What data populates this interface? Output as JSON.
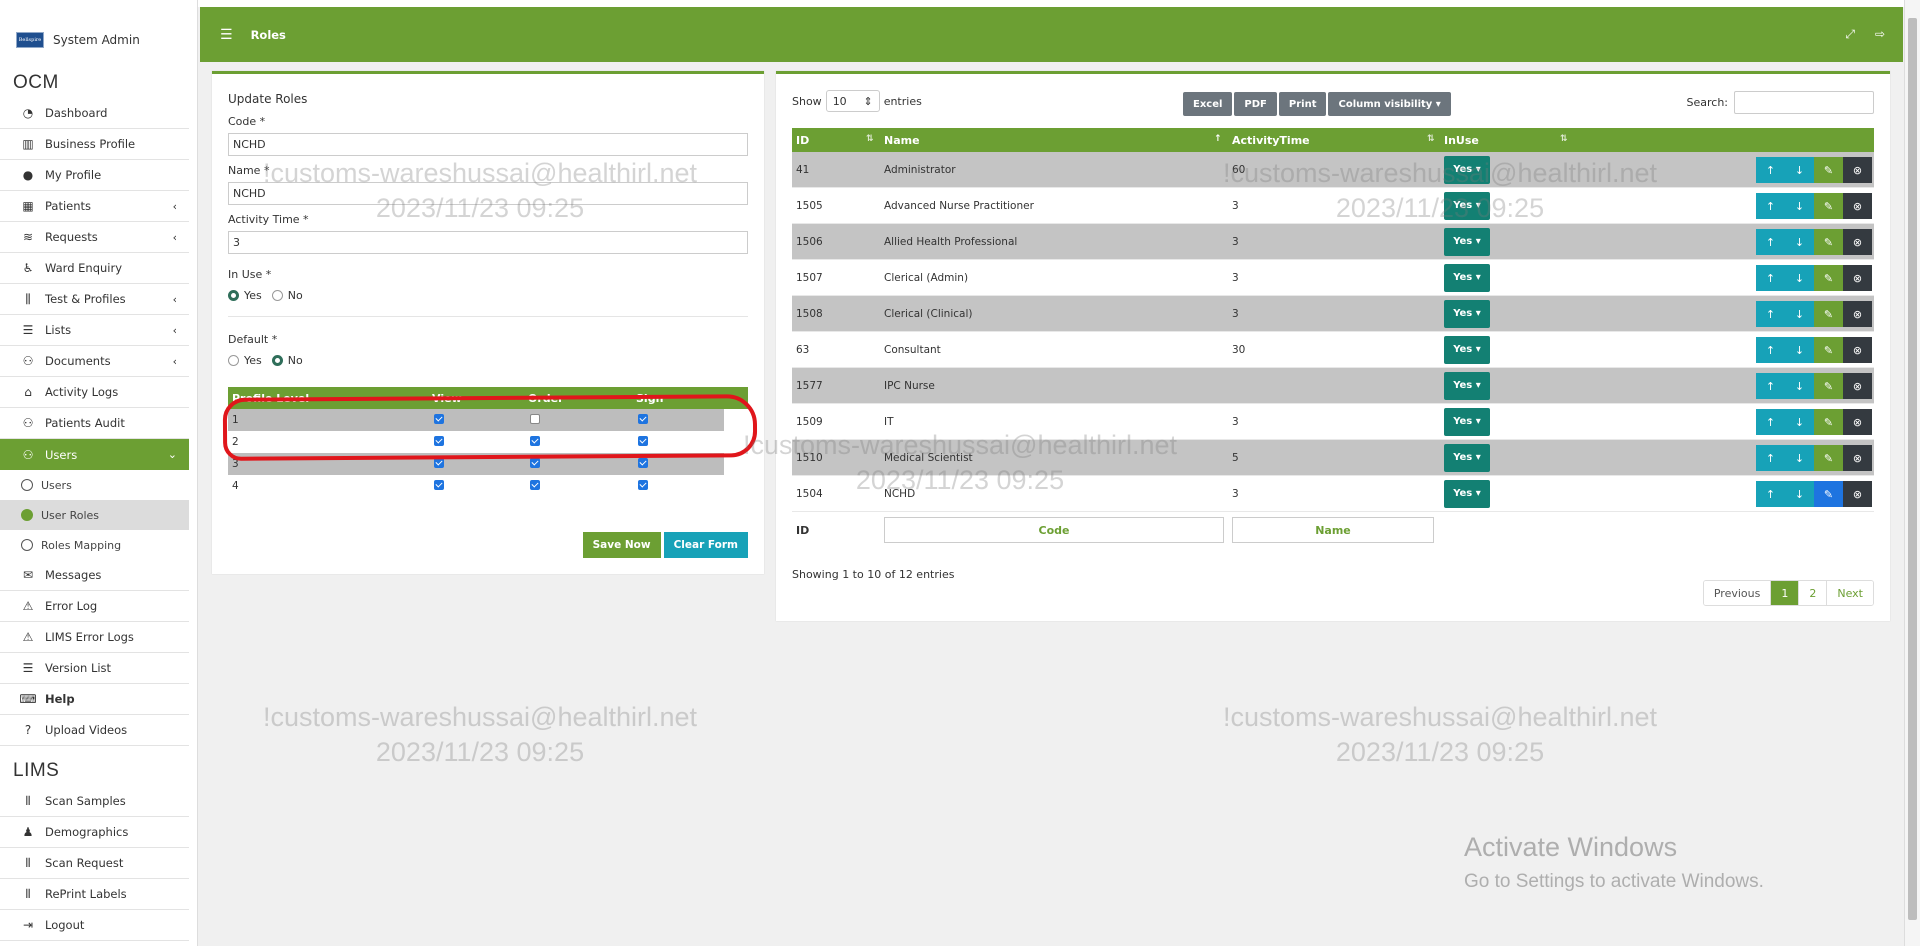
{
  "sidebar": {
    "brand_logo": "Bellspire",
    "brand_name": "System Admin",
    "ocm_title": "OCM",
    "ocm_items": [
      {
        "label": "Dashboard"
      },
      {
        "label": "Business Profile"
      },
      {
        "label": "My Profile"
      },
      {
        "label": "Patients"
      },
      {
        "label": "Requests"
      },
      {
        "label": "Ward Enquiry"
      },
      {
        "label": "Test & Profiles"
      },
      {
        "label": "Lists"
      },
      {
        "label": "Documents"
      },
      {
        "label": "Activity Logs"
      },
      {
        "label": "Patients Audit"
      },
      {
        "label": "Users"
      }
    ],
    "users_sub": [
      {
        "label": "Users"
      },
      {
        "label": "User Roles"
      },
      {
        "label": "Roles Mapping"
      }
    ],
    "after_items": [
      {
        "label": "Messages"
      },
      {
        "label": "Error Log"
      },
      {
        "label": "LIMS Error Logs"
      },
      {
        "label": "Version List"
      },
      {
        "label": "Help"
      },
      {
        "label": "Upload Videos"
      }
    ],
    "lims_title": "LIMS",
    "lims_items": [
      {
        "label": "Scan Samples"
      },
      {
        "label": "Demographics"
      },
      {
        "label": "Scan Request"
      },
      {
        "label": "RePrint Labels"
      },
      {
        "label": "Logout"
      }
    ]
  },
  "header": {
    "title": "Roles"
  },
  "form": {
    "title": "Update Roles",
    "code_label": "Code *",
    "code_value": "NCHD",
    "name_label": "Name *",
    "name_value": "NCHD",
    "activity_label": "Activity Time *",
    "activity_value": "3",
    "inuse_label": "In Use *",
    "default_label": "Default *",
    "yes": "Yes",
    "no": "No",
    "inuse_selected": "Yes",
    "default_selected": "No",
    "profile_headers": [
      "Profile Level",
      "View",
      "Order",
      "Sign"
    ],
    "profile_rows": [
      {
        "level": "1",
        "view": true,
        "order": false,
        "sign": true
      },
      {
        "level": "2",
        "view": true,
        "order": true,
        "sign": true
      },
      {
        "level": "3",
        "view": true,
        "order": true,
        "sign": true
      },
      {
        "level": "4",
        "view": true,
        "order": true,
        "sign": true
      }
    ],
    "save_label": "Save Now",
    "clear_label": "Clear Form"
  },
  "table": {
    "show_label": "Show",
    "entries_value": "10",
    "entries_label": "entries",
    "buttons": [
      "Excel",
      "PDF",
      "Print",
      "Column visibility ▾"
    ],
    "search_label": "Search:",
    "headers": [
      "ID",
      "Name",
      "ActivityTime",
      "InUse"
    ],
    "rows": [
      {
        "id": "41",
        "name": "Administrator",
        "time": "60",
        "inuse": "Yes"
      },
      {
        "id": "1505",
        "name": "Advanced Nurse Practitioner",
        "time": "3",
        "inuse": "Yes"
      },
      {
        "id": "1506",
        "name": "Allied Health Professional",
        "time": "3",
        "inuse": "Yes"
      },
      {
        "id": "1507",
        "name": "Clerical (Admin)",
        "time": "3",
        "inuse": "Yes"
      },
      {
        "id": "1508",
        "name": "Clerical (Clinical)",
        "time": "3",
        "inuse": "Yes"
      },
      {
        "id": "63",
        "name": "Consultant",
        "time": "30",
        "inuse": "Yes"
      },
      {
        "id": "1577",
        "name": "IPC Nurse",
        "time": "",
        "inuse": "Yes"
      },
      {
        "id": "1509",
        "name": "IT",
        "time": "3",
        "inuse": "Yes"
      },
      {
        "id": "1510",
        "name": "Medical Scientist",
        "time": "5",
        "inuse": "Yes"
      },
      {
        "id": "1504",
        "name": "NCHD",
        "time": "3",
        "inuse": "Yes"
      }
    ],
    "filter_id_label": "ID",
    "filter_code_placeholder": "Code",
    "filter_name_placeholder": "Name",
    "info": "Showing 1 to 10 of 12 entries",
    "pagination": [
      "Previous",
      "1",
      "2",
      "Next"
    ]
  },
  "watermark": {
    "line1": "!customs-wareshussai@healthirl.net",
    "line2": "2023/11/23 09:25"
  },
  "activate": {
    "line1": "Activate Windows",
    "line2": "Go to Settings to activate Windows."
  },
  "colors": {
    "accent": "#6c9f33",
    "teal": "#17a2b8",
    "yes_button": "#138073",
    "highlight": "#e0161b"
  }
}
